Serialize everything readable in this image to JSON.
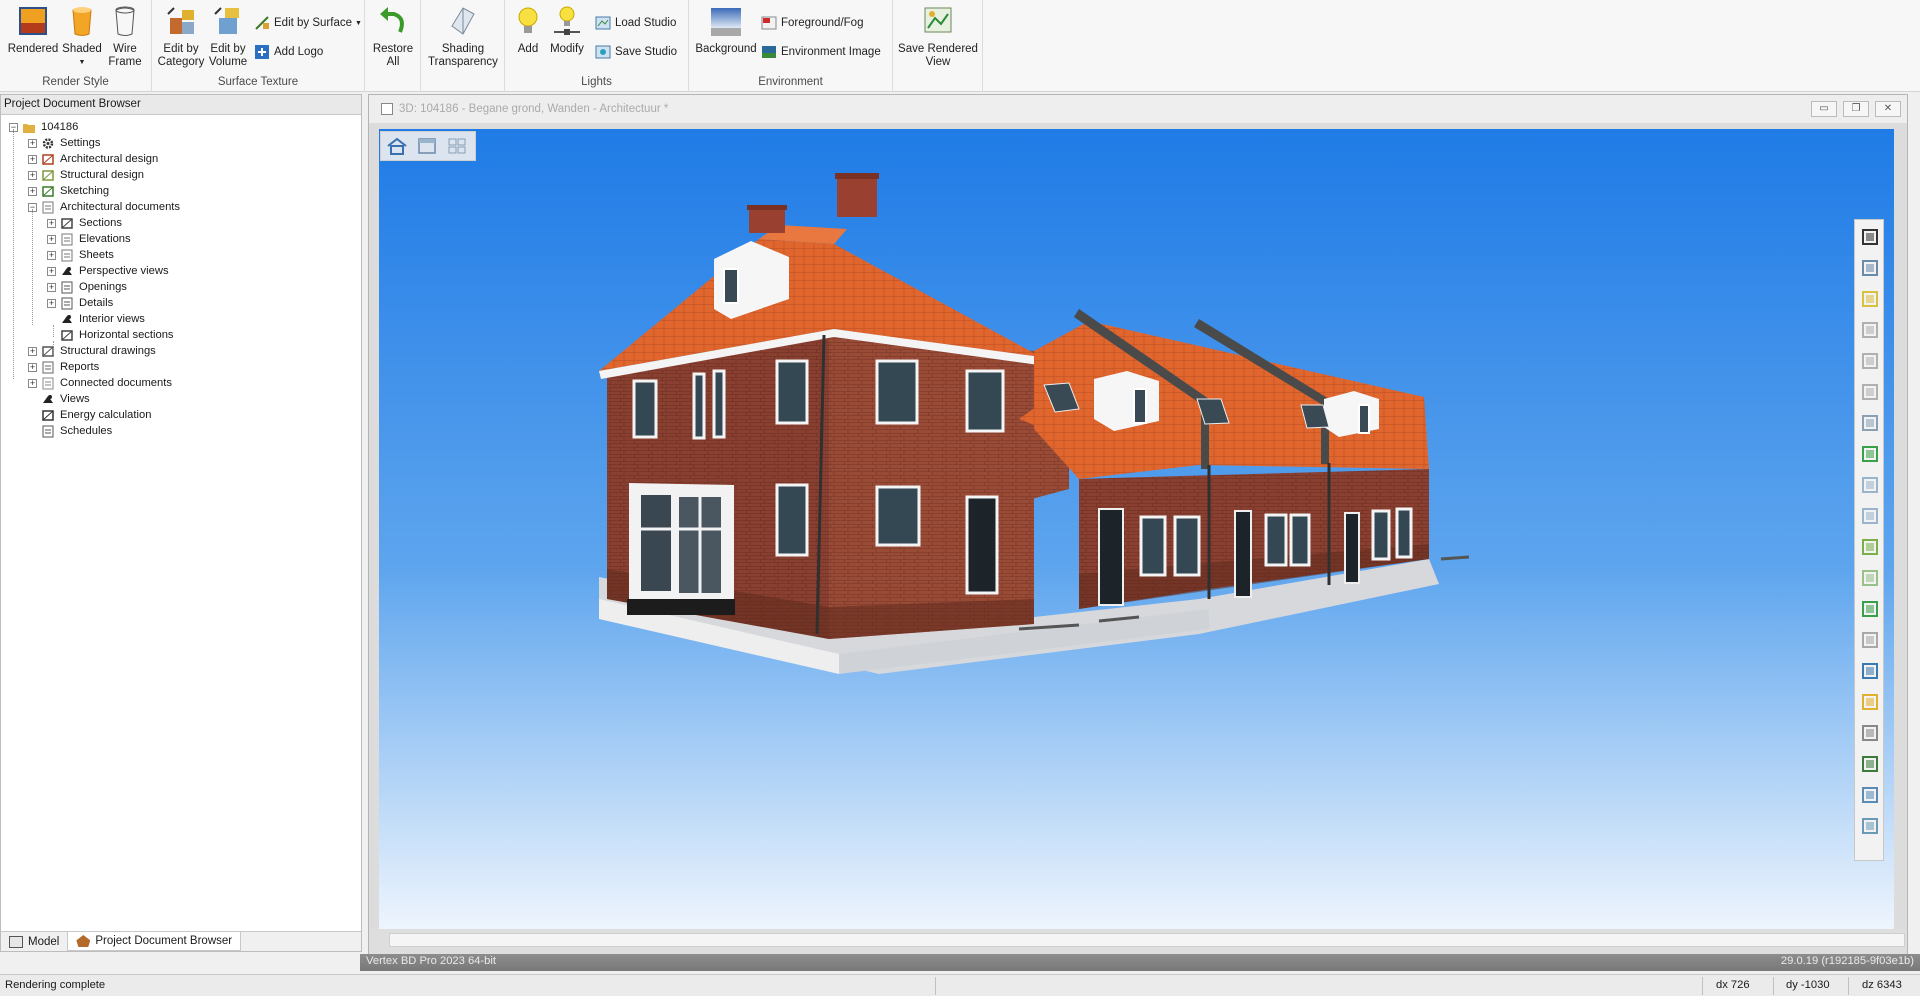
{
  "ribbon": {
    "render_style": {
      "label": "Render Style",
      "rendered": "Rendered",
      "shaded": "Shaded",
      "wire_frame_1": "Wire",
      "wire_frame_2": "Frame"
    },
    "surface_texture": {
      "label": "Surface Texture",
      "edit_by_category_1": "Edit by",
      "edit_by_category_2": "Category",
      "edit_by_volume_1": "Edit by",
      "edit_by_volume_2": "Volume",
      "edit_by_surface": "Edit by Surface",
      "add_logo": "Add Logo"
    },
    "restore": {
      "line1": "Restore",
      "line2": "All"
    },
    "shading": {
      "line1": "Shading",
      "line2": "Transparency"
    },
    "lights": {
      "label": "Lights",
      "add": "Add",
      "modify": "Modify",
      "load_studio": "Load Studio",
      "save_studio": "Save Studio"
    },
    "environment": {
      "label": "Environment",
      "background": "Background",
      "foreground_fog": "Foreground/Fog",
      "environment_image": "Environment Image"
    },
    "save_rendered": {
      "line1": "Save Rendered",
      "line2": "View"
    }
  },
  "left_panel": {
    "title": "Project Document Browser",
    "tree": [
      {
        "label": "104186",
        "icon": "folder-icon"
      },
      {
        "label": "Settings",
        "icon": "gear-icon"
      },
      {
        "label": "Architectural design",
        "icon": "house-icon"
      },
      {
        "label": "Structural design",
        "icon": "beam-icon"
      },
      {
        "label": "Sketching",
        "icon": "pencil-icon"
      },
      {
        "label": "Architectural documents",
        "icon": "documents-icon"
      },
      {
        "label": "Sections",
        "icon": "section-icon"
      },
      {
        "label": "Elevations",
        "icon": "elevation-icon"
      },
      {
        "label": "Sheets",
        "icon": "sheet-icon"
      },
      {
        "label": "Perspective views",
        "icon": "camera-icon"
      },
      {
        "label": "Openings",
        "icon": "opening-icon"
      },
      {
        "label": "Details",
        "icon": "detail-icon"
      },
      {
        "label": "Interior views",
        "icon": "camera-icon"
      },
      {
        "label": "Horizontal sections",
        "icon": "section-icon"
      },
      {
        "label": "Structural drawings",
        "icon": "drawing-icon"
      },
      {
        "label": "Reports",
        "icon": "report-icon"
      },
      {
        "label": "Connected documents",
        "icon": "document-icon"
      },
      {
        "label": "Views",
        "icon": "camera-icon"
      },
      {
        "label": "Energy calculation",
        "icon": "calculator-icon"
      },
      {
        "label": "Schedules",
        "icon": "schedule-icon"
      }
    ],
    "tabs": {
      "model": "Model",
      "browser": "Project Document Browser"
    }
  },
  "viewport": {
    "title": "3D: 104186 - Begane grond, Wanden - Architectuur *"
  },
  "vertex_bar": {
    "product": "Vertex BD Pro  2023  64-bit",
    "version": "29.0.19 (r192185-9f03e1b)"
  },
  "status": {
    "message": "Rendering complete",
    "dx": "dx 726",
    "dy": "dy -1030",
    "dz": "dz 6343"
  }
}
